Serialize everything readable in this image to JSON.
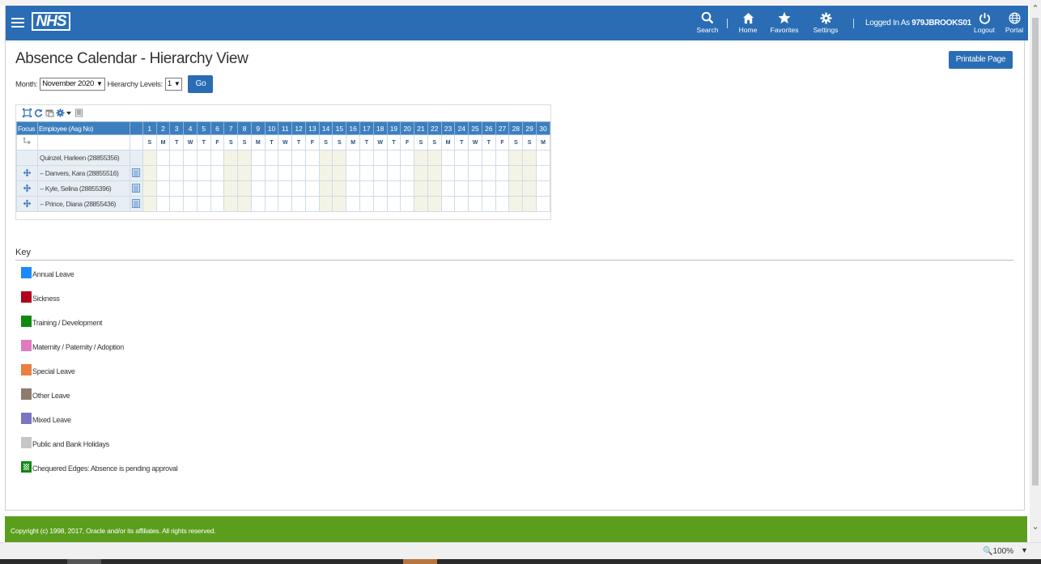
{
  "header": {
    "logo": "NHS",
    "search_label": "Search",
    "home_label": "Home",
    "favorites_label": "Favorites",
    "settings_label": "Settings",
    "logged_in_prefix": "Logged In As",
    "username": "979JBROOKS01",
    "logout_label": "Logout",
    "portal_label": "Portal"
  },
  "page": {
    "title": "Absence Calendar - Hierarchy View",
    "printable_label": "Printable Page"
  },
  "filters": {
    "month_label": "Month:",
    "month_value": "November 2020",
    "levels_label": "Hierarchy Levels:",
    "levels_value": "1",
    "go_label": "Go"
  },
  "calendar": {
    "focus_header": "Focus",
    "employee_header": "Employee (Asg No)",
    "days": [
      "1",
      "2",
      "3",
      "4",
      "5",
      "6",
      "7",
      "8",
      "9",
      "10",
      "11",
      "12",
      "13",
      "14",
      "15",
      "16",
      "17",
      "18",
      "19",
      "20",
      "21",
      "22",
      "23",
      "24",
      "25",
      "26",
      "27",
      "28",
      "29",
      "30"
    ],
    "weekdays": [
      "S",
      "M",
      "T",
      "W",
      "T",
      "F",
      "S",
      "S",
      "M",
      "T",
      "W",
      "T",
      "F",
      "S",
      "S",
      "M",
      "T",
      "W",
      "T",
      "F",
      "S",
      "S",
      "M",
      "T",
      "W",
      "T",
      "F",
      "S",
      "S",
      "M"
    ],
    "employees": [
      {
        "name": "Quinzel, Harleen (28855356)"
      },
      {
        "name": "-- Danvers, Kara (28855516)"
      },
      {
        "name": "-- Kyle, Selina (28855396)"
      },
      {
        "name": "-- Prince, Diana (28855436)"
      }
    ]
  },
  "key": {
    "title": "Key",
    "items": [
      {
        "label": "Annual Leave",
        "color": "#1e88ff"
      },
      {
        "label": "Sickness",
        "color": "#b3001b"
      },
      {
        "label": "Training / Development",
        "color": "#0f8a10"
      },
      {
        "label": "Maternity / Paternity / Adoption",
        "color": "#e07ac0"
      },
      {
        "label": "Special Leave",
        "color": "#ea8040"
      },
      {
        "label": "Other Leave",
        "color": "#8c7b6e"
      },
      {
        "label": "Mixed Leave",
        "color": "#7a74c4"
      },
      {
        "label": "Public and Bank Holidays",
        "color": "#c6c6c6"
      },
      {
        "label": "Chequered Edges: Absence is pending approval",
        "color": "#0f8a10"
      }
    ]
  },
  "footer": {
    "copyright": "Copyright (c) 1998, 2017, Oracle and/or its affiliates. All rights reserved."
  },
  "status": {
    "zoom": "100%"
  },
  "colors": {
    "brand": "#2a6db5",
    "footer": "#5b9e1d"
  }
}
